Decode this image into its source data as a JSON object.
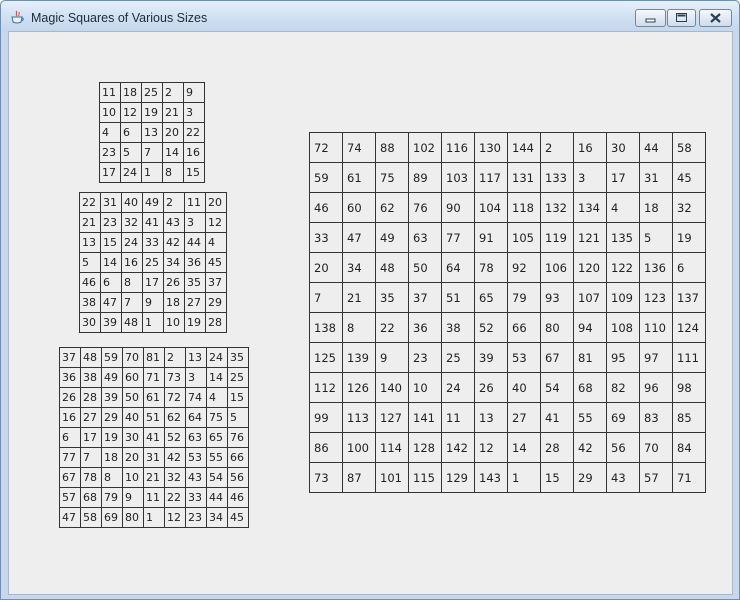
{
  "window": {
    "title": "Magic Squares of Various Sizes",
    "icon": "java-cup-icon",
    "controls": [
      "minimize-icon",
      "maximize-icon",
      "close-icon"
    ]
  },
  "squares": [
    {
      "size": 5,
      "rows": [
        [
          11,
          18,
          25,
          2,
          9
        ],
        [
          10,
          12,
          19,
          21,
          3
        ],
        [
          4,
          6,
          13,
          20,
          22
        ],
        [
          23,
          5,
          7,
          14,
          16
        ],
        [
          17,
          24,
          1,
          8,
          15
        ]
      ]
    },
    {
      "size": 7,
      "rows": [
        [
          22,
          31,
          40,
          49,
          2,
          11,
          20
        ],
        [
          21,
          23,
          32,
          41,
          43,
          3,
          12
        ],
        [
          13,
          15,
          24,
          33,
          42,
          44,
          4
        ],
        [
          5,
          14,
          16,
          25,
          34,
          36,
          45
        ],
        [
          46,
          6,
          8,
          17,
          26,
          35,
          37
        ],
        [
          38,
          47,
          7,
          9,
          18,
          27,
          29
        ],
        [
          30,
          39,
          48,
          1,
          10,
          19,
          28
        ]
      ]
    },
    {
      "size": 9,
      "rows": [
        [
          37,
          48,
          59,
          70,
          81,
          2,
          13,
          24,
          35
        ],
        [
          36,
          38,
          49,
          60,
          71,
          73,
          3,
          14,
          25
        ],
        [
          26,
          28,
          39,
          50,
          61,
          72,
          74,
          4,
          15
        ],
        [
          16,
          27,
          29,
          40,
          51,
          62,
          64,
          75,
          5
        ],
        [
          6,
          17,
          19,
          30,
          41,
          52,
          63,
          65,
          76
        ],
        [
          77,
          7,
          18,
          20,
          31,
          42,
          53,
          55,
          66
        ],
        [
          67,
          78,
          8,
          10,
          21,
          32,
          43,
          54,
          56
        ],
        [
          57,
          68,
          79,
          9,
          11,
          22,
          33,
          44,
          46
        ],
        [
          47,
          58,
          69,
          80,
          1,
          12,
          23,
          34,
          45
        ]
      ]
    },
    {
      "size": 12,
      "rows": [
        [
          72,
          74,
          88,
          102,
          116,
          130,
          144,
          2,
          16,
          30,
          44,
          58
        ],
        [
          59,
          61,
          75,
          89,
          103,
          117,
          131,
          133,
          3,
          17,
          31,
          45
        ],
        [
          46,
          60,
          62,
          76,
          90,
          104,
          118,
          132,
          134,
          4,
          18,
          32
        ],
        [
          33,
          47,
          49,
          63,
          77,
          91,
          105,
          119,
          121,
          135,
          5,
          19
        ],
        [
          20,
          34,
          48,
          50,
          64,
          78,
          92,
          106,
          120,
          122,
          136,
          6
        ],
        [
          7,
          21,
          35,
          37,
          51,
          65,
          79,
          93,
          107,
          109,
          123,
          137
        ],
        [
          138,
          8,
          22,
          36,
          38,
          52,
          66,
          80,
          94,
          108,
          110,
          124
        ],
        [
          125,
          139,
          9,
          23,
          25,
          39,
          53,
          67,
          81,
          95,
          97,
          111
        ],
        [
          112,
          126,
          140,
          10,
          24,
          26,
          40,
          54,
          68,
          82,
          96,
          98
        ],
        [
          99,
          113,
          127,
          141,
          11,
          13,
          27,
          41,
          55,
          69,
          83,
          85
        ],
        [
          86,
          100,
          114,
          128,
          142,
          12,
          14,
          28,
          42,
          56,
          70,
          84
        ],
        [
          73,
          87,
          101,
          115,
          129,
          143,
          1,
          15,
          29,
          43,
          57,
          71
        ]
      ]
    }
  ]
}
